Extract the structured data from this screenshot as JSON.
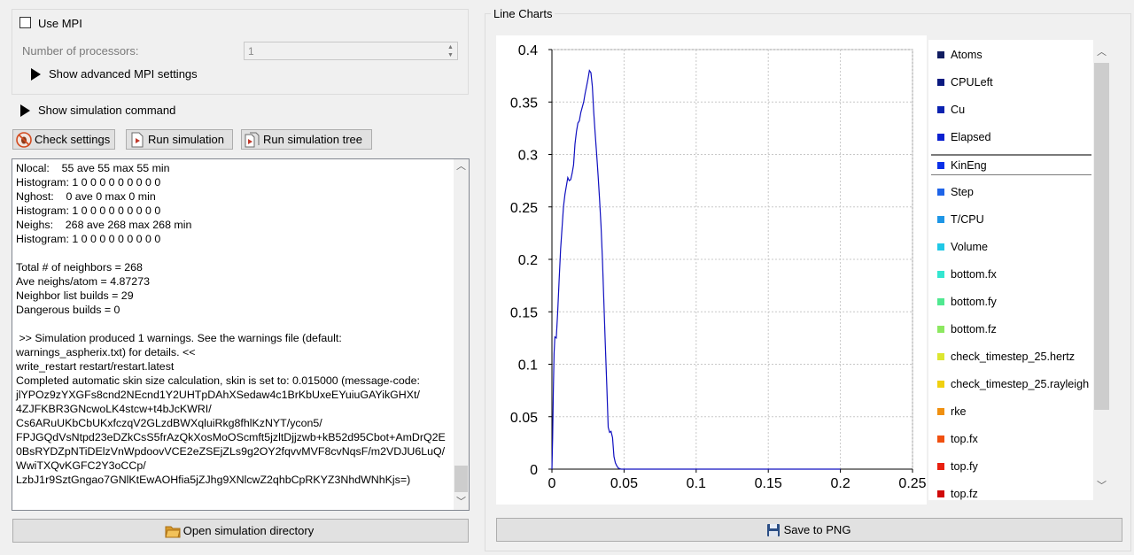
{
  "mpi": {
    "use_mpi_label": "Use MPI",
    "use_mpi_checked": false,
    "processors_label": "Number of processors:",
    "processors_value": "1",
    "advanced_label": "Show advanced MPI settings"
  },
  "sim_command_label": "Show simulation command",
  "toolbar": {
    "check_label": "Check settings",
    "run_label": "Run simulation",
    "run_tree_label": "Run simulation tree"
  },
  "console": {
    "lines": [
      "Nlocal:    55 ave 55 max 55 min",
      "Histogram: 1 0 0 0 0 0 0 0 0 0",
      "Nghost:    0 ave 0 max 0 min",
      "Histogram: 1 0 0 0 0 0 0 0 0 0",
      "Neighs:    268 ave 268 max 268 min",
      "Histogram: 1 0 0 0 0 0 0 0 0 0",
      "",
      "Total # of neighbors = 268",
      "Ave neighs/atom = 4.87273",
      "Neighbor list builds = 29",
      "Dangerous builds = 0",
      "",
      " >> Simulation produced 1 warnings. See the warnings file (default:",
      "warnings_aspherix.txt) for details. <<",
      "write_restart restart/restart.latest",
      "Completed automatic skin size calculation, skin is set to: 0.015000 (message-code:",
      "jlYPOz9zYXGFs8cnd2NEcnd1Y2UHTpDAhXSedaw4c1BrKbUxeEYuiuGAYikGHXt/",
      "4ZJFKBR3GNcwoLK4stcw+t4bJcKWRI/",
      "Cs6ARuUKbCbUKxfczqV2GLzdBWXqluiRkg8fhlKzNYT/ycon5/",
      "FPJGQdVsNtpd23eDZkCsS5frAzQkXosMoOScmft5jzltDjjzwb+kB52d95Cbot+AmDrQ2E",
      "0BsRYDZpNTiDElzVnWpdoovVCE2eZSEjZLs9g2OY2fqvvMVF8cvNqsF/m2VDJU6LuQ/",
      "WwiTXQvKGFC2Y3oCCp/",
      "LzbJ1r9SztGngao7GNlKtEwAOHfia5jZJhg9XNlcwZ2qhbCpRKYZ3NhdWNhKjs=)"
    ]
  },
  "open_dir_label": "Open simulation directory",
  "chart_group_title": "Line Charts",
  "save_png_label": "Save to PNG",
  "legend": {
    "selected": "KinEng",
    "items": [
      {
        "label": "Atoms",
        "color": "#101c60"
      },
      {
        "label": "CPULeft",
        "color": "#0a1a80"
      },
      {
        "label": "Cu",
        "color": "#0a22b0"
      },
      {
        "label": "Elapsed",
        "color": "#0a20d0"
      },
      {
        "label": "KinEng",
        "color": "#0a30e8"
      },
      {
        "label": "Step",
        "color": "#1e64e8"
      },
      {
        "label": "T/CPU",
        "color": "#1e96e6"
      },
      {
        "label": "Volume",
        "color": "#20c8e6"
      },
      {
        "label": "bottom.fx",
        "color": "#34e6d0"
      },
      {
        "label": "bottom.fy",
        "color": "#50e890"
      },
      {
        "label": "bottom.fz",
        "color": "#8ce860"
      },
      {
        "label": "check_timestep_25.hertz",
        "color": "#dce630"
      },
      {
        "label": "check_timestep_25.rayleigh",
        "color": "#f0d010"
      },
      {
        "label": "rke",
        "color": "#f09010"
      },
      {
        "label": "top.fx",
        "color": "#f05010"
      },
      {
        "label": "top.fy",
        "color": "#e82010"
      },
      {
        "label": "top.fz",
        "color": "#d00a0a"
      }
    ]
  },
  "chart_data": {
    "type": "line",
    "title": "",
    "xlabel": "",
    "ylabel": "",
    "xlim": [
      0,
      0.25
    ],
    "ylim": [
      0,
      0.4
    ],
    "x_ticks": [
      "0",
      "0.05",
      "0.1",
      "0.15",
      "0.2",
      "0.25"
    ],
    "y_ticks": [
      "0",
      "0.05",
      "0.1",
      "0.15",
      "0.2",
      "0.25",
      "0.3",
      "0.35",
      "0.4"
    ],
    "grid": true,
    "series": [
      {
        "name": "KinEng",
        "color": "#1010c0",
        "x": [
          0.0,
          0.0005,
          0.001,
          0.0015,
          0.002,
          0.003,
          0.004,
          0.005,
          0.006,
          0.007,
          0.008,
          0.009,
          0.01,
          0.011,
          0.012,
          0.013,
          0.014,
          0.015,
          0.016,
          0.017,
          0.018,
          0.019,
          0.02,
          0.021,
          0.022,
          0.023,
          0.024,
          0.025,
          0.026,
          0.027,
          0.028,
          0.029,
          0.03,
          0.031,
          0.032,
          0.033,
          0.034,
          0.035,
          0.036,
          0.037,
          0.038,
          0.039,
          0.04,
          0.041,
          0.042,
          0.043,
          0.044,
          0.045,
          0.046,
          0.047,
          0.048,
          0.05,
          0.055,
          0.06,
          0.1,
          0.15,
          0.2
        ],
        "y": [
          0.0,
          0.03,
          0.075,
          0.11,
          0.126,
          0.125,
          0.15,
          0.18,
          0.21,
          0.23,
          0.25,
          0.262,
          0.27,
          0.278,
          0.275,
          0.276,
          0.282,
          0.29,
          0.31,
          0.322,
          0.33,
          0.332,
          0.34,
          0.345,
          0.35,
          0.358,
          0.365,
          0.372,
          0.38,
          0.378,
          0.365,
          0.34,
          0.32,
          0.3,
          0.28,
          0.258,
          0.232,
          0.2,
          0.16,
          0.12,
          0.08,
          0.04,
          0.035,
          0.036,
          0.03,
          0.012,
          0.006,
          0.003,
          0.001,
          0.0005,
          0.0,
          0.0,
          0.0,
          0.0,
          0.0,
          0.0,
          0.0
        ]
      }
    ]
  }
}
